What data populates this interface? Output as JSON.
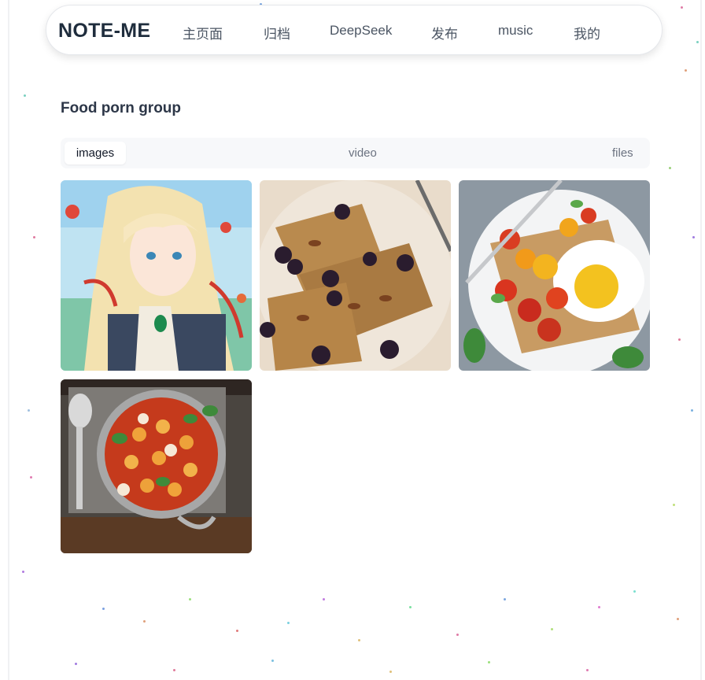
{
  "nav": {
    "brand": "NOTE-ME",
    "links": [
      "主页面",
      "归档",
      "DeepSeek",
      "发布",
      "music",
      "我的"
    ]
  },
  "section": {
    "title": "Food porn group",
    "tabs": [
      {
        "label": "images",
        "active": true
      },
      {
        "label": "video",
        "active": false
      },
      {
        "label": "files",
        "active": false
      }
    ]
  },
  "gallery": [
    {
      "name": "anime-girl-image",
      "subject": "anime girl with blonde hair"
    },
    {
      "name": "french-toast-image",
      "subject": "french toast with blackberries and pecans"
    },
    {
      "name": "egg-toast-image",
      "subject": "fried egg toast with tomatoes"
    },
    {
      "name": "gnocchi-pan-image",
      "subject": "gnocchi in tomato sauce pan"
    }
  ],
  "colors": {
    "brand": "#1f2d3d",
    "tab_bg": "#f7f8fa",
    "text_muted": "#6b7280"
  }
}
